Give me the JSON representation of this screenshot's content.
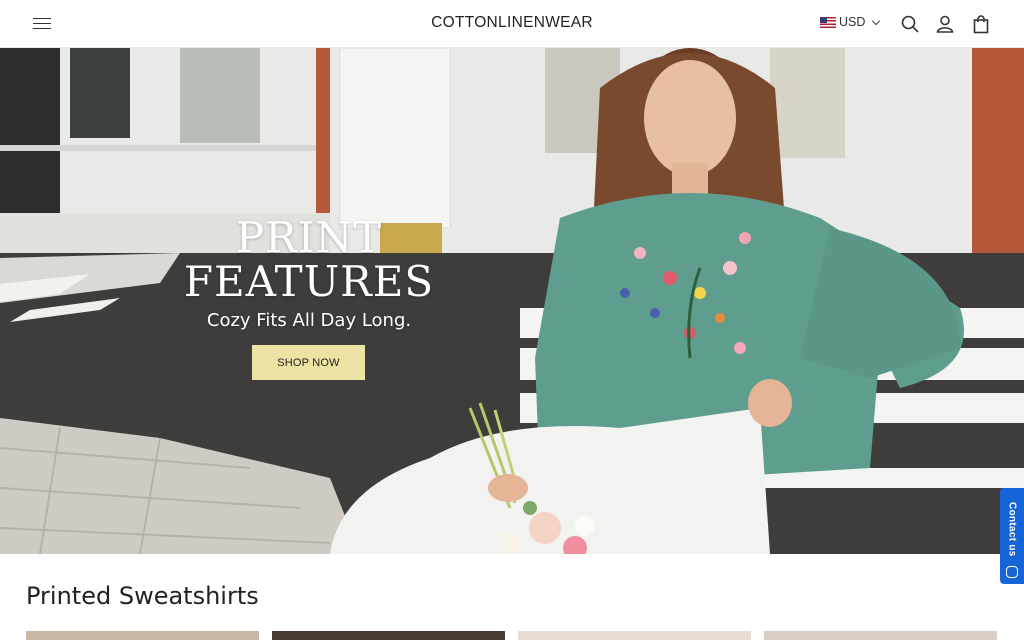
{
  "header": {
    "brand": "COTTONLINENWEAR",
    "currency": "USD",
    "icons": [
      "menu-icon",
      "us-flag-icon",
      "chevron-down-icon",
      "search-icon",
      "account-icon",
      "cart-icon"
    ]
  },
  "hero": {
    "title_line1": "PRINT",
    "title_line2": "FEATURES",
    "subtitle": "Cozy Fits All Day Long.",
    "cta_label": "SHOP NOW",
    "cta_color": "#ece3a4"
  },
  "contact_tab": {
    "label": "Contact us",
    "color": "#1565d8"
  },
  "section": {
    "title": "Printed Sweatshirts",
    "cards": [
      {
        "id": "card-1",
        "bg": "#c9b8a8"
      },
      {
        "id": "card-2",
        "bg": "#4a3b33"
      },
      {
        "id": "card-3",
        "bg": "#e7dcd3"
      },
      {
        "id": "card-4",
        "bg": "#dacfc7"
      }
    ]
  }
}
